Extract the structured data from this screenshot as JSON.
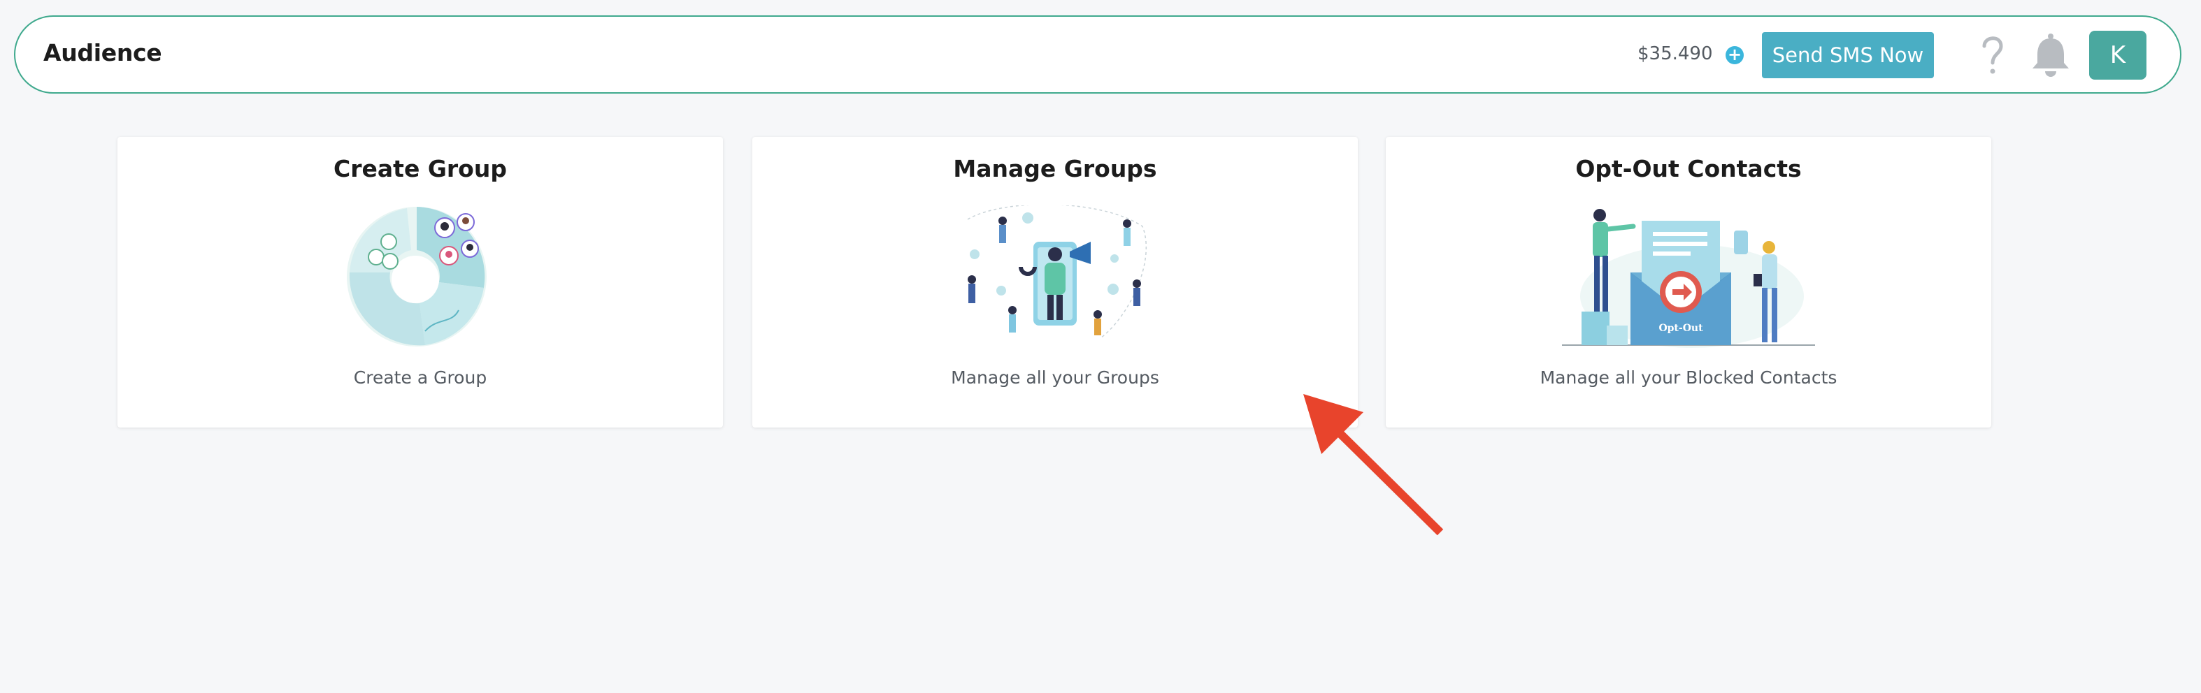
{
  "header": {
    "title": "Audience",
    "balance": "$35.490",
    "add_funds_icon": "plus-circle-icon",
    "send_sms_label": "Send SMS Now",
    "help_icon": "question-mark-icon",
    "notifications_icon": "bell-icon",
    "avatar_initial": "K"
  },
  "cards": [
    {
      "title": "Create Group",
      "description": "Create a Group",
      "illustration": "create-group-illustration"
    },
    {
      "title": "Manage Groups",
      "description": "Manage all your Groups",
      "illustration": "manage-groups-illustration"
    },
    {
      "title": "Opt-Out Contacts",
      "description": "Manage all your Blocked Contacts",
      "illustration": "opt-out-illustration",
      "illustration_text": "Opt-Out"
    }
  ],
  "annotation": {
    "type": "arrow",
    "color": "#e8442c",
    "points_to": "manage-groups-card"
  },
  "colors": {
    "accent_border": "#3fa98d",
    "send_button": "#4aaec4",
    "avatar": "#4aa89f",
    "add_icon": "#3bb6dc",
    "page_background": "#f6f7f9"
  }
}
